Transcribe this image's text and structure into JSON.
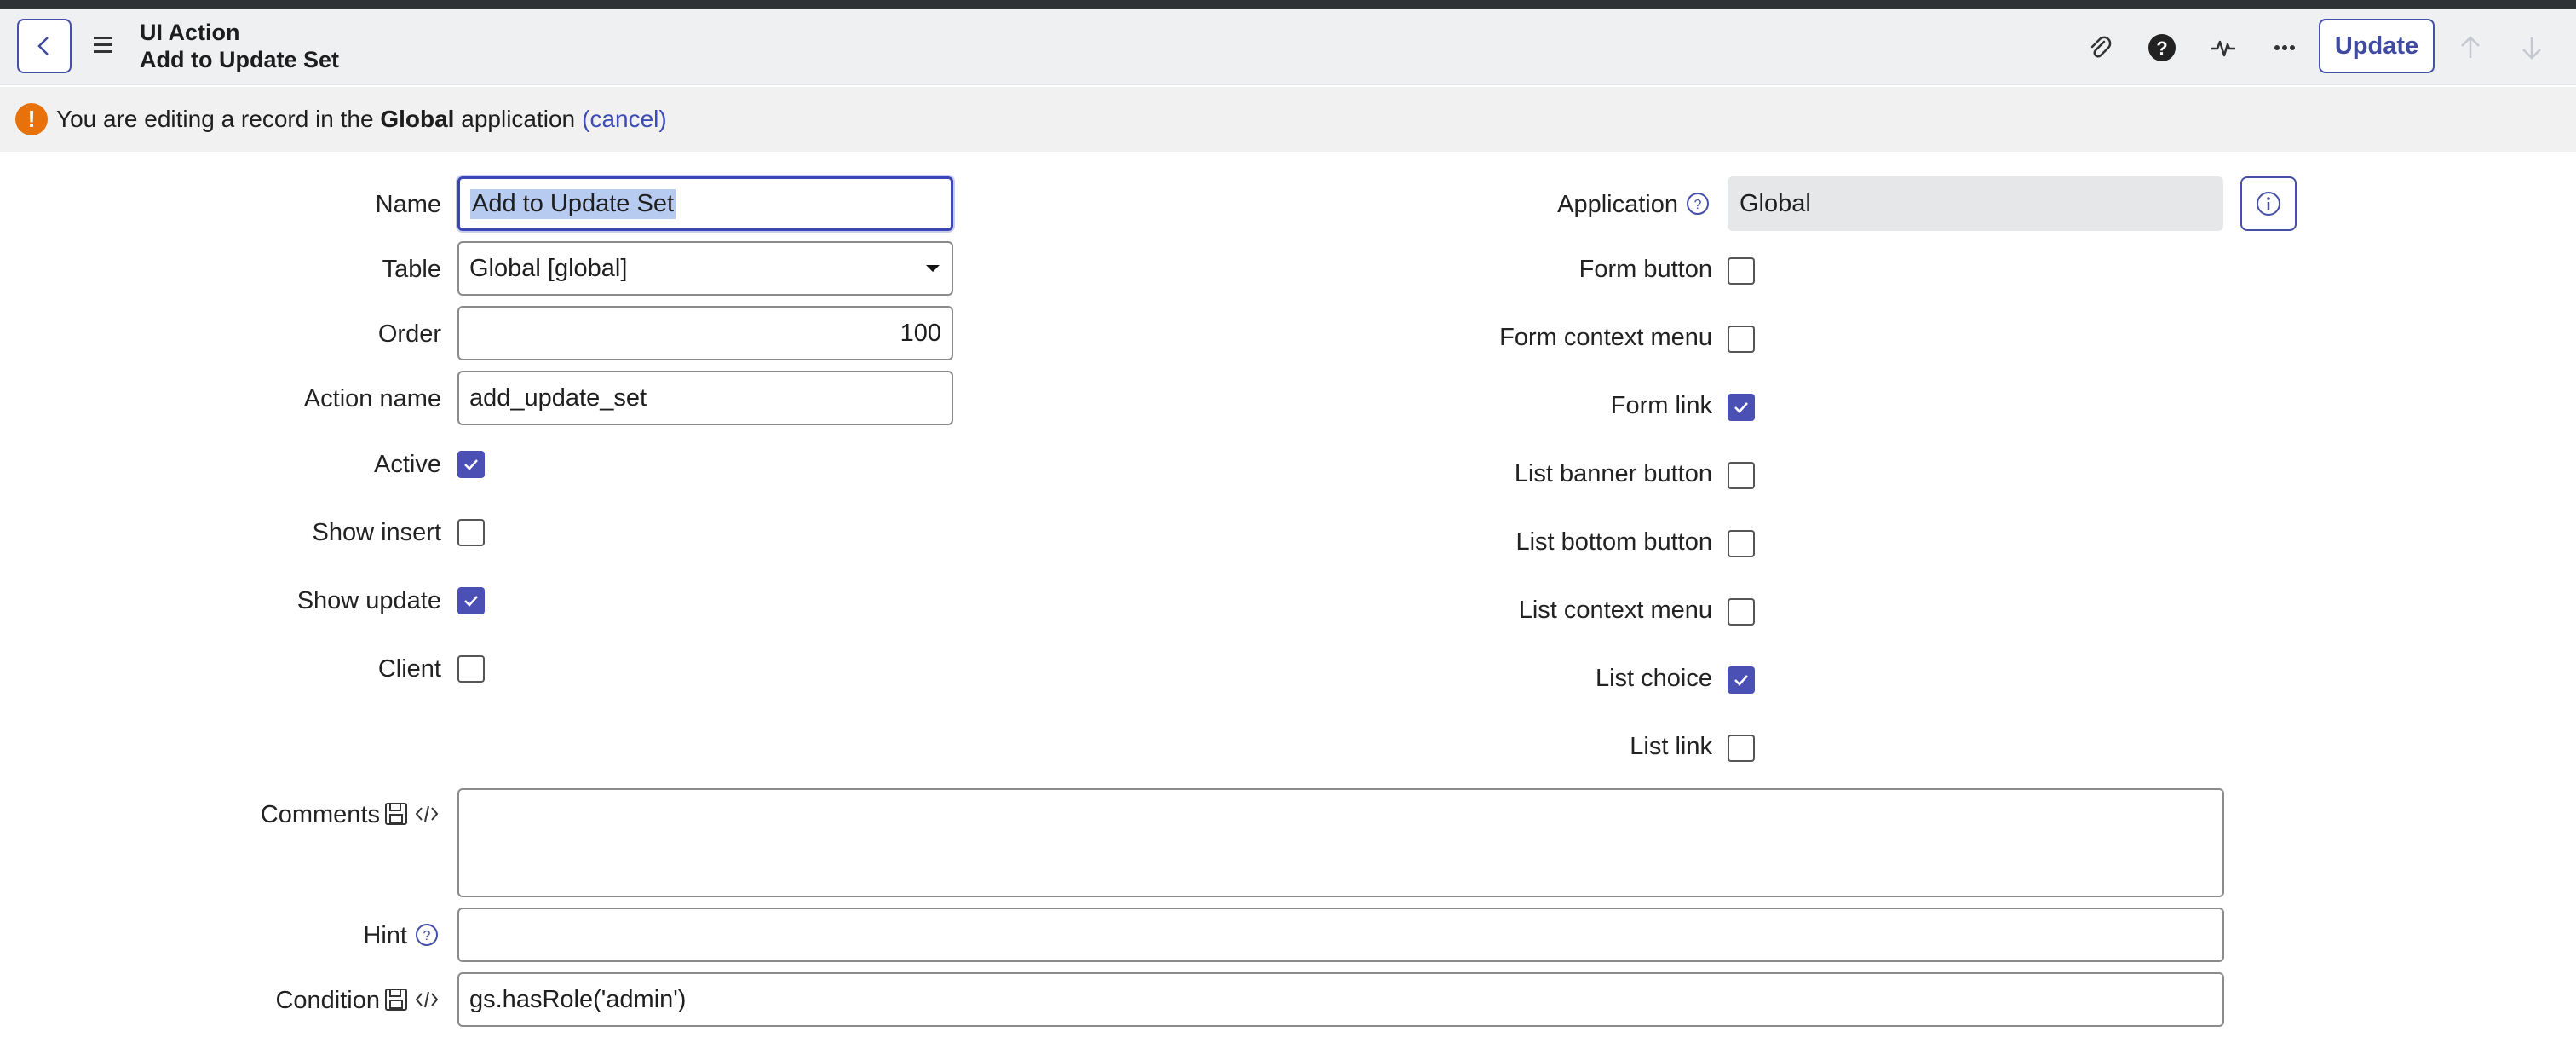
{
  "header": {
    "record_type": "UI Action",
    "record_name": "Add to Update Set",
    "update_label": "Update"
  },
  "banner": {
    "text_before": "You are editing a record in the",
    "app_name": "Global",
    "text_after": "application",
    "cancel_link": "(cancel)"
  },
  "form_left": {
    "name_label": "Name",
    "name_value": "Add to Update Set",
    "table_label": "Table",
    "table_value": "Global [global]",
    "order_label": "Order",
    "order_value": "100",
    "action_name_label": "Action name",
    "action_name_value": "add_update_set",
    "active_label": "Active",
    "active_checked": true,
    "show_insert_label": "Show insert",
    "show_insert_checked": false,
    "show_update_label": "Show update",
    "show_update_checked": true,
    "client_label": "Client",
    "client_checked": false
  },
  "form_right": {
    "application_label": "Application",
    "application_value": "Global",
    "form_button_label": "Form button",
    "form_button_checked": false,
    "form_context_menu_label": "Form context menu",
    "form_context_menu_checked": false,
    "form_link_label": "Form link",
    "form_link_checked": true,
    "list_banner_button_label": "List banner button",
    "list_banner_button_checked": false,
    "list_bottom_button_label": "List bottom button",
    "list_bottom_button_checked": false,
    "list_context_menu_label": "List context menu",
    "list_context_menu_checked": false,
    "list_choice_label": "List choice",
    "list_choice_checked": true,
    "list_link_label": "List link",
    "list_link_checked": false
  },
  "form_full": {
    "comments_label": "Comments",
    "comments_value": "",
    "hint_label": "Hint",
    "hint_value": "",
    "condition_label": "Condition",
    "condition_value": "gs.hasRole('admin')"
  },
  "icons": {
    "back": "chevron-left-icon",
    "menu": "hamburger-icon",
    "attachment": "paperclip-icon",
    "help": "question-circle-icon",
    "activity": "pulse-icon",
    "more": "ellipsis-icon",
    "up": "arrow-up-icon",
    "down": "arrow-down-icon",
    "warning": "exclamation-icon",
    "info": "info-icon"
  },
  "colors": {
    "accent": "#4a50b4",
    "warning": "#e8710a",
    "header_bg": "#eef0f2"
  }
}
